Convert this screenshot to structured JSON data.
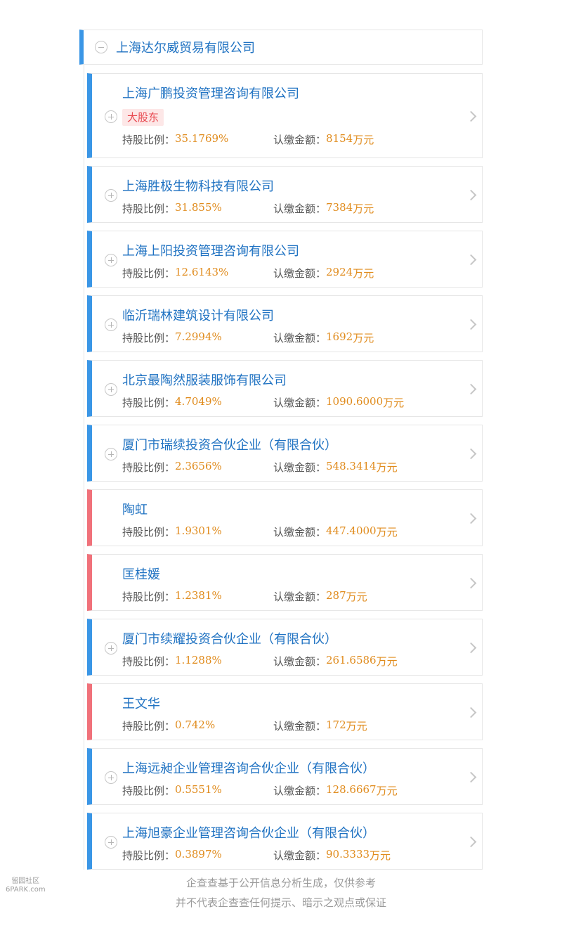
{
  "root": {
    "name": "上海达尔威贸易有限公司"
  },
  "labels": {
    "ratio": "持股比例：",
    "amount": "认缴金额："
  },
  "shareholders": [
    {
      "name": "上海广鹏投资管理咨询有限公司",
      "tag": "大股东",
      "ratio": "35.1769%",
      "amount_num": "8154",
      "amount_unit": "万元",
      "type": "company"
    },
    {
      "name": "上海胜极生物科技有限公司",
      "ratio": "31.855%",
      "amount_num": "7384",
      "amount_unit": "万元",
      "type": "company"
    },
    {
      "name": "上海上阳投资管理咨询有限公司",
      "ratio": "12.6143%",
      "amount_num": "2924",
      "amount_unit": "万元",
      "type": "company"
    },
    {
      "name": "临沂瑞林建筑设计有限公司",
      "ratio": "7.2994%",
      "amount_num": "1692",
      "amount_unit": "万元",
      "type": "company"
    },
    {
      "name": "北京最陶然服装服饰有限公司",
      "ratio": "4.7049%",
      "amount_num": "1090.6000",
      "amount_unit": "万元",
      "type": "company"
    },
    {
      "name": "厦门市瑞续投资合伙企业（有限合伙）",
      "ratio": "2.3656%",
      "amount_num": "548.3414",
      "amount_unit": "万元",
      "type": "company"
    },
    {
      "name": "陶虹",
      "ratio": "1.9301%",
      "amount_num": "447.4000",
      "amount_unit": "万元",
      "type": "person"
    },
    {
      "name": "匡桂媛",
      "ratio": "1.2381%",
      "amount_num": "287",
      "amount_unit": "万元",
      "type": "person"
    },
    {
      "name": "厦门市续耀投资合伙企业（有限合伙）",
      "ratio": "1.1288%",
      "amount_num": "261.6586",
      "amount_unit": "万元",
      "type": "company"
    },
    {
      "name": "王文华",
      "ratio": "0.742%",
      "amount_num": "172",
      "amount_unit": "万元",
      "type": "person"
    },
    {
      "name": "上海远昶企业管理咨询合伙企业（有限合伙）",
      "ratio": "0.5551%",
      "amount_num": "128.6667",
      "amount_unit": "万元",
      "type": "company"
    },
    {
      "name": "上海旭豪企业管理咨询合伙企业（有限合伙）",
      "ratio": "0.3897%",
      "amount_num": "90.3333",
      "amount_unit": "万元",
      "type": "company"
    }
  ],
  "footer": {
    "line1": "企查查基于公开信息分析生成，仅供参考",
    "line2": "并不代表企查查任何提示、暗示之观点或保证"
  },
  "watermark": {
    "line1": "留园社区",
    "line2": "6PARK.com"
  },
  "colors": {
    "company_bar": "#3a96e6",
    "person_bar": "#f0717a",
    "name": "#1f72c2",
    "value": "#e08b1c"
  }
}
